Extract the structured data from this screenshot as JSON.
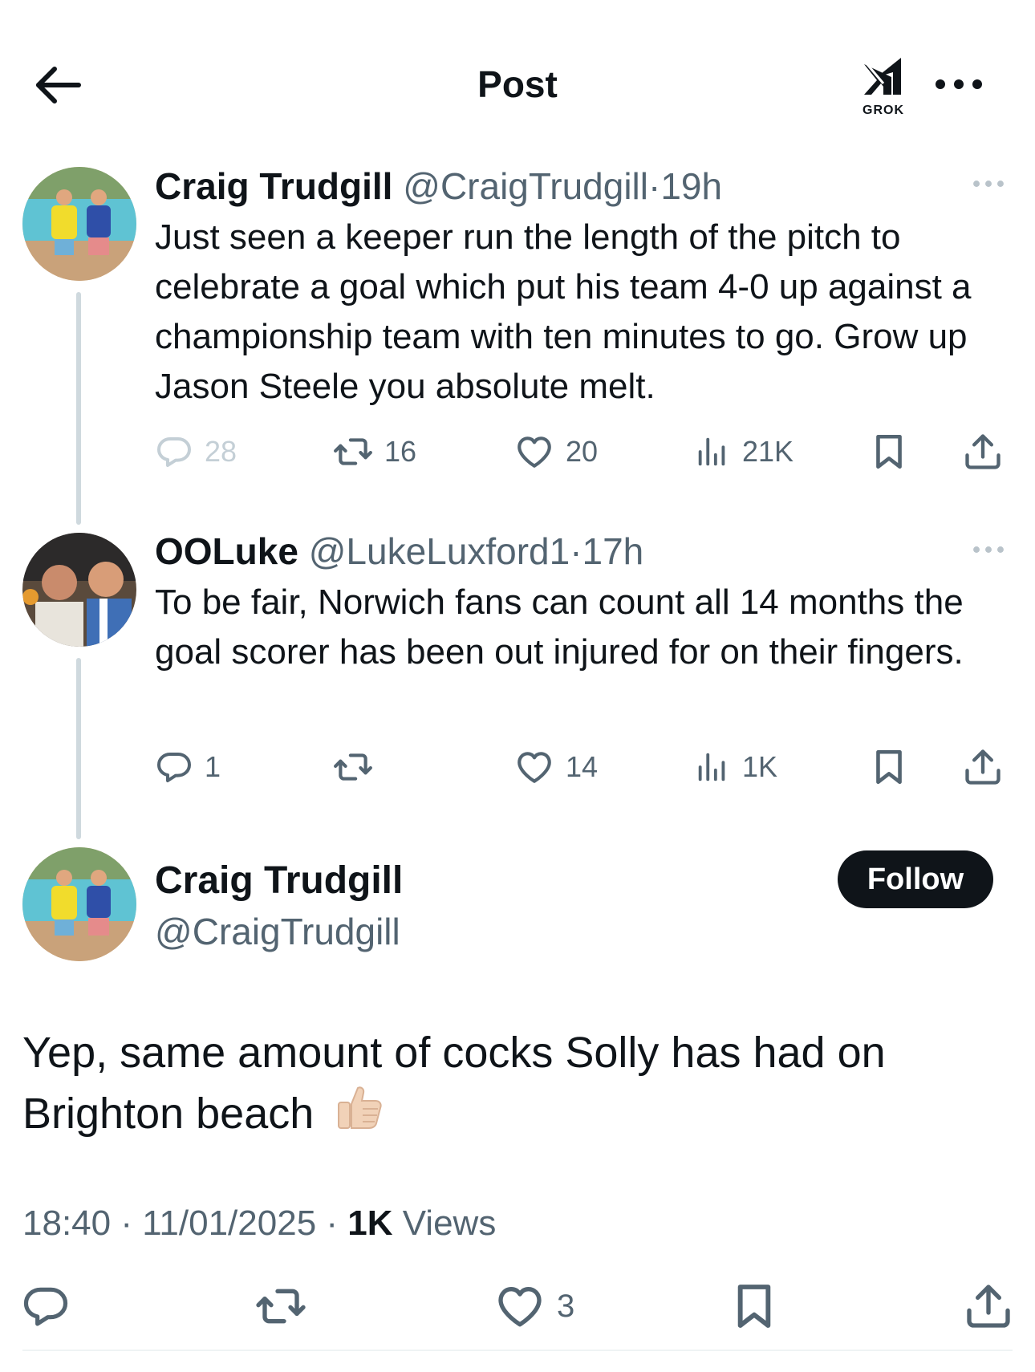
{
  "header": {
    "title": "Post",
    "grok_label": "GROK"
  },
  "thread": [
    {
      "name": "Craig Trudgill",
      "handle": "@CraigTrudgill",
      "separator": "·",
      "time": "19h",
      "text": "Just seen a keeper run the length of the pitch to celebrate a goal which put his team 4-0 up against a championship team with ten minutes to go. Grow up Jason Steele you absolute melt.",
      "stats": {
        "replies": "28",
        "reposts": "16",
        "likes": "20",
        "views": "21K"
      }
    },
    {
      "name": "OOLuke",
      "handle": "@LukeLuxford1",
      "separator": "·",
      "time": "17h",
      "text": "To be fair, Norwich fans can count all 14 months the goal scorer has been out injured for on their fingers.",
      "stats": {
        "replies": "1",
        "reposts": "",
        "likes": "14",
        "views": "1K"
      }
    }
  ],
  "main_post": {
    "name": "Craig Trudgill",
    "handle": "@CraigTrudgill",
    "follow_label": "Follow",
    "text": "Yep, same amount of cocks Solly has had on Brighton beach",
    "emoji": "thumbs-up",
    "timestamp": "18:40 · 11/01/2025 · ",
    "views_count": "1K",
    "views_label": " Views",
    "stats": {
      "replies": "",
      "reposts": "",
      "likes": "3"
    }
  },
  "colors": {
    "text": "#0f1419",
    "secondary": "#536471",
    "faded": "#c4cfd6",
    "thread_line": "#cfd9de",
    "follow_bg": "#0f1419"
  }
}
